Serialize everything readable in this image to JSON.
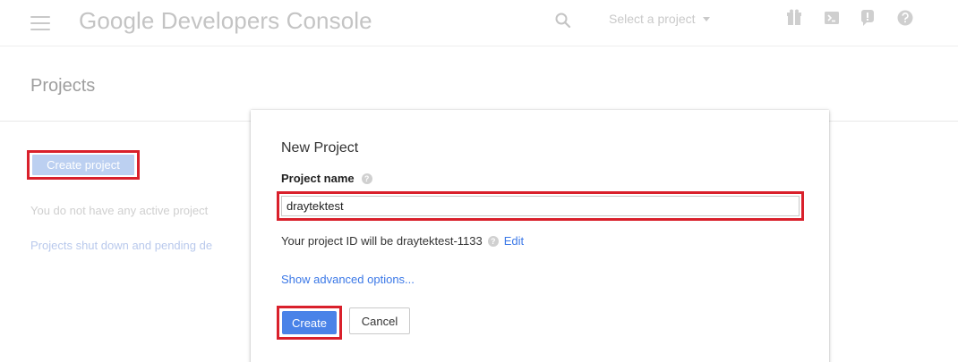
{
  "topbar": {
    "app_title": "Google Developers Console",
    "project_selector": "Select a project",
    "icons": [
      "menu-icon",
      "search-icon",
      "gift-icon",
      "cloud-shell-icon",
      "notifications-icon",
      "help-icon"
    ]
  },
  "page": {
    "title": "Projects",
    "create_project_label": "Create project",
    "no_projects_text": "You do not have any active project",
    "shutdown_link_text": "Projects shut down and pending de"
  },
  "dialog": {
    "title": "New Project",
    "project_name_label": "Project name",
    "project_name_value": "draytektest",
    "project_id_text": "Your project ID will be draytektest-1133",
    "edit_label": "Edit",
    "advanced_label": "Show advanced options...",
    "create_label": "Create",
    "cancel_label": "Cancel"
  },
  "colors": {
    "accent_blue": "#4a83e8",
    "link_blue": "#3b78e7",
    "highlight_red": "#d9202b"
  }
}
